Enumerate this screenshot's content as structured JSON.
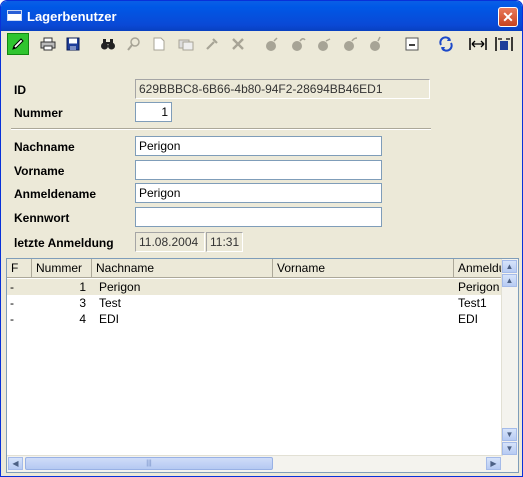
{
  "window": {
    "title": "Lagerbenutzer",
    "close_glyph": "✕"
  },
  "toolbar": {
    "buttons": [
      {
        "name": "edit-pencil-icon",
        "glyph": "✎"
      },
      {
        "name": "print-icon",
        "glyph": "🖶"
      },
      {
        "name": "save-icon",
        "glyph": "💾"
      },
      {
        "name": "search-binoculars-icon",
        "glyph": "🔭"
      },
      {
        "name": "zoom-icon",
        "glyph": "🔍"
      },
      {
        "name": "new-document-icon",
        "glyph": "🗋"
      },
      {
        "name": "copy-records-icon",
        "glyph": "⧉"
      },
      {
        "name": "tools-icon",
        "glyph": "✂"
      },
      {
        "name": "delete-icon",
        "glyph": "✕"
      },
      {
        "name": "bomb-icon",
        "glyph": "●"
      },
      {
        "name": "bomb-fuse-icon",
        "glyph": "●"
      },
      {
        "name": "bomb-alt-icon",
        "glyph": "●"
      },
      {
        "name": "bomb-alt2-icon",
        "glyph": "●"
      },
      {
        "name": "bomb-alt3-icon",
        "glyph": "●"
      },
      {
        "name": "minus-icon",
        "glyph": "-"
      },
      {
        "name": "refresh-link-icon",
        "glyph": "⟲"
      },
      {
        "name": "split-horizontal-icon",
        "glyph": "⇹"
      },
      {
        "name": "split-save-icon",
        "glyph": "⇹"
      }
    ]
  },
  "form": {
    "id_label": "ID",
    "id_value": "629BBBC8-6B66-4b80-94F2-28694BB46ED1",
    "nummer_label": "Nummer",
    "nummer_value": "1",
    "nachname_label": "Nachname",
    "nachname_value": "Perigon",
    "vorname_label": "Vorname",
    "vorname_value": "",
    "anmeldename_label": "Anmeldename",
    "anmeldename_value": "Perigon",
    "kennwort_label": "Kennwort",
    "kennwort_value": "",
    "letzte_label": "letzte Anmeldung",
    "letzte_date": "11.08.2004",
    "letzte_time": "11:31"
  },
  "grid": {
    "columns": [
      "F",
      "Nummer",
      "Nachname",
      "Vorname",
      "Anmeldu"
    ],
    "rows": [
      {
        "f": "-",
        "nummer": "1",
        "nachname": "Perigon",
        "vorname": "",
        "anmeldename": "Perigon"
      },
      {
        "f": "-",
        "nummer": "3",
        "nachname": "Test",
        "vorname": "",
        "anmeldename": "Test1"
      },
      {
        "f": "-",
        "nummer": "4",
        "nachname": "EDI",
        "vorname": "",
        "anmeldename": "EDI"
      }
    ],
    "scroll_up": "▲",
    "scroll_up2": "▲",
    "scroll_down": "▼",
    "scroll_down2": "▼",
    "scroll_left": "◀",
    "scroll_right": "▶",
    "hthumb_grip": "|||"
  }
}
